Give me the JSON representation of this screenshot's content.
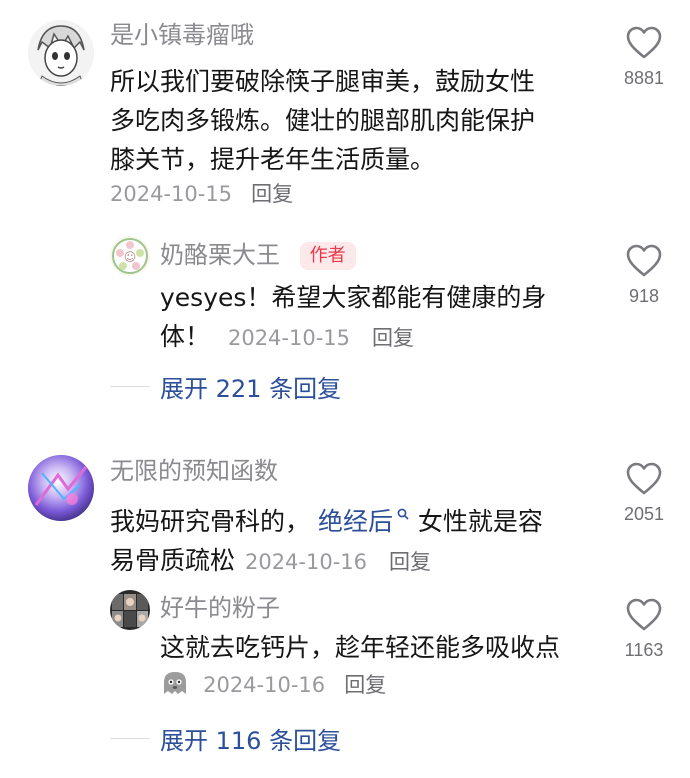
{
  "comments": [
    {
      "username": "是小镇毒瘤哦",
      "text_lines": [
        "所以我们要破除筷子腿审美，鼓励女性",
        "多吃肉多锻炼。健壮的腿部肌肉能保护",
        "膝关节，提升老年生活质量。"
      ],
      "date": "2024-10-15",
      "reply_label": "回复",
      "likes": "8881",
      "reply": {
        "username": "奶酪栗大王",
        "badge": "作者",
        "text_line1": "yesyes！希望大家都能有健康的身",
        "text_line2": "体！",
        "date": "2024-10-15",
        "reply_label": "回复",
        "likes": "918"
      },
      "expand_label": "展开 221 条回复"
    },
    {
      "username": "无限的预知函数",
      "text_pre": "我妈研究骨科的，",
      "link_text": "绝经后",
      "text_post": "女性就是容",
      "text_line2": "易骨质疏松",
      "date": "2024-10-16",
      "reply_label": "回复",
      "likes": "2051",
      "reply": {
        "username": "好牛的粉子",
        "text_line1": "这就去吃钙片，趁年轻还能多吸收点",
        "date": "2024-10-16",
        "reply_label": "回复",
        "likes": "1163"
      },
      "expand_label": "展开 116 条回复"
    }
  ],
  "colors": {
    "username": "#8a8a8f",
    "body": "#161616",
    "link": "#2b4f9b",
    "badge_bg": "#fde8ea",
    "badge_text": "#e8394b"
  },
  "icons": {
    "like": "heart-outline-icon",
    "search_hint": "search-icon",
    "sticker": "ghost-sticker-icon"
  }
}
